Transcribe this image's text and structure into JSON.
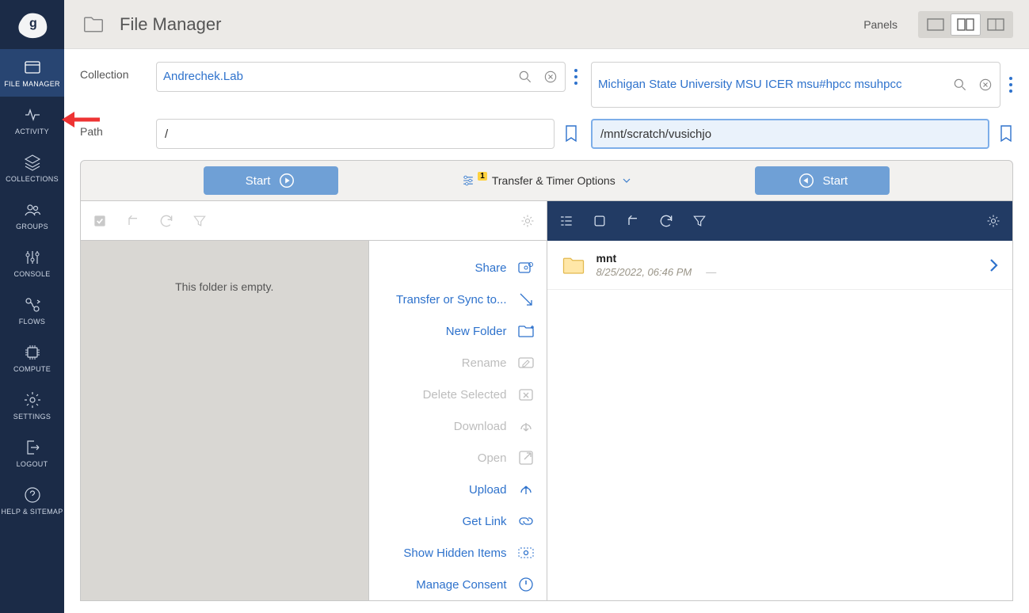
{
  "header": {
    "title": "File Manager",
    "panels_label": "Panels"
  },
  "sidenav": {
    "items": [
      {
        "label": "FILE MANAGER"
      },
      {
        "label": "ACTIVITY"
      },
      {
        "label": "COLLECTIONS"
      },
      {
        "label": "GROUPS"
      },
      {
        "label": "CONSOLE"
      },
      {
        "label": "FLOWS"
      },
      {
        "label": "COMPUTE"
      },
      {
        "label": "SETTINGS"
      },
      {
        "label": "LOGOUT"
      },
      {
        "label": "HELP & SITEMAP"
      }
    ]
  },
  "labels": {
    "collection": "Collection",
    "path": "Path"
  },
  "left": {
    "collection": "Andrechek.Lab",
    "path": "/",
    "empty_msg": "This folder is empty."
  },
  "right": {
    "collection": "Michigan State University MSU ICER msu#hpcc msuhpcc",
    "path": "/mnt/scratch/vusichjo",
    "files": [
      {
        "name": "mnt",
        "date": "8/25/2022, 06:46 PM"
      }
    ]
  },
  "transfer": {
    "start": "Start",
    "options": "Transfer & Timer Options",
    "badge": "1"
  },
  "actions": {
    "share": "Share",
    "transfer": "Transfer or Sync to...",
    "new_folder": "New Folder",
    "rename": "Rename",
    "delete": "Delete Selected",
    "download": "Download",
    "open": "Open",
    "upload": "Upload",
    "get_link": "Get Link",
    "show_hidden": "Show Hidden Items",
    "manage_consent": "Manage Consent"
  }
}
